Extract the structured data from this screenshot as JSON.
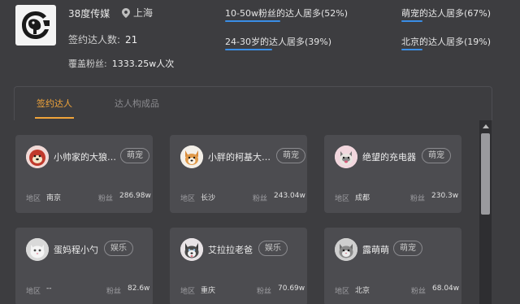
{
  "company": {
    "name": "38度传媒",
    "location": "上海"
  },
  "summary": {
    "signed_label": "签约达人数:",
    "signed_value": "21",
    "coverage_label": "覆盖粉丝:",
    "coverage_value": "1333.25w人次"
  },
  "stats": [
    {
      "highlight": "10-50w",
      "rest": "粉丝的达人居多(52%)"
    },
    {
      "highlight": "24-30",
      "rest": "岁的达人居多(39%)"
    },
    {
      "highlight": "萌宠",
      "rest": "的达人居多(67%)"
    },
    {
      "highlight": "北京",
      "rest": "的达人居多(19%)"
    }
  ],
  "tabs": [
    {
      "label": "签约达人",
      "active": true
    },
    {
      "label": "达人构成品",
      "active": false
    }
  ],
  "region_label": "地区",
  "fans_label": "粉丝",
  "cards": [
    {
      "name": "小帅家的大狼…",
      "tag": "萌宠",
      "region": "南京",
      "fans": "286.98w",
      "avatar": "dog-red"
    },
    {
      "name": "小胖的柯基大…",
      "tag": "萌宠",
      "region": "长沙",
      "fans": "243.04w",
      "avatar": "corgi"
    },
    {
      "name": "绝望的充电器",
      "tag": "萌宠",
      "region": "成都",
      "fans": "230.3w",
      "avatar": "cat-pink"
    },
    {
      "name": "蛋妈程小勺",
      "tag": "娱乐",
      "region": "--",
      "fans": "82.6w",
      "avatar": "cat-white"
    },
    {
      "name": "艾拉拉老爸",
      "tag": "娱乐",
      "region": "重庆",
      "fans": "70.69w",
      "avatar": "husky"
    },
    {
      "name": "露萌萌",
      "tag": "萌宠",
      "region": "北京",
      "fans": "68.04w",
      "avatar": "cat-grey"
    }
  ]
}
